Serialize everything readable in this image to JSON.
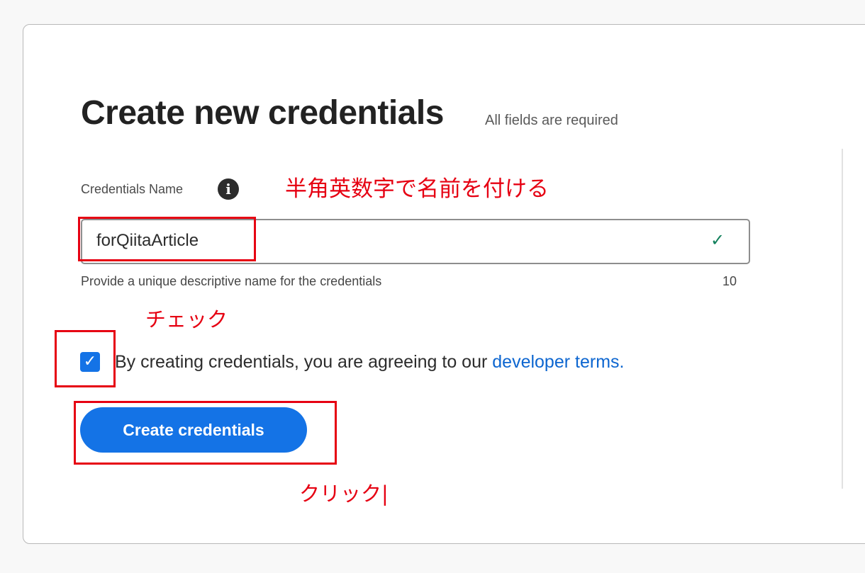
{
  "form": {
    "title": "Create new credentials",
    "subtitle": "All fields are required",
    "name_label": "Credentials Name",
    "info_icon_glyph": "i",
    "name_value": "forQiitaArticle",
    "valid_icon_glyph": "✓",
    "help_text": "Provide a unique descriptive name for the credentials",
    "char_counter": "10",
    "terms_checked": true,
    "checkbox_glyph": "✓",
    "terms_text": "By creating credentials, you are agreeing to our ",
    "terms_link": "developer terms.",
    "submit_label": "Create credentials"
  },
  "annotations": {
    "name_note": "半角英数字で名前を付ける",
    "check_note": "チェック",
    "click_note": "クリック|",
    "color": "#e60012"
  },
  "colors": {
    "accent": "#1473e6",
    "link": "#0d66d0",
    "valid": "#12805c"
  }
}
